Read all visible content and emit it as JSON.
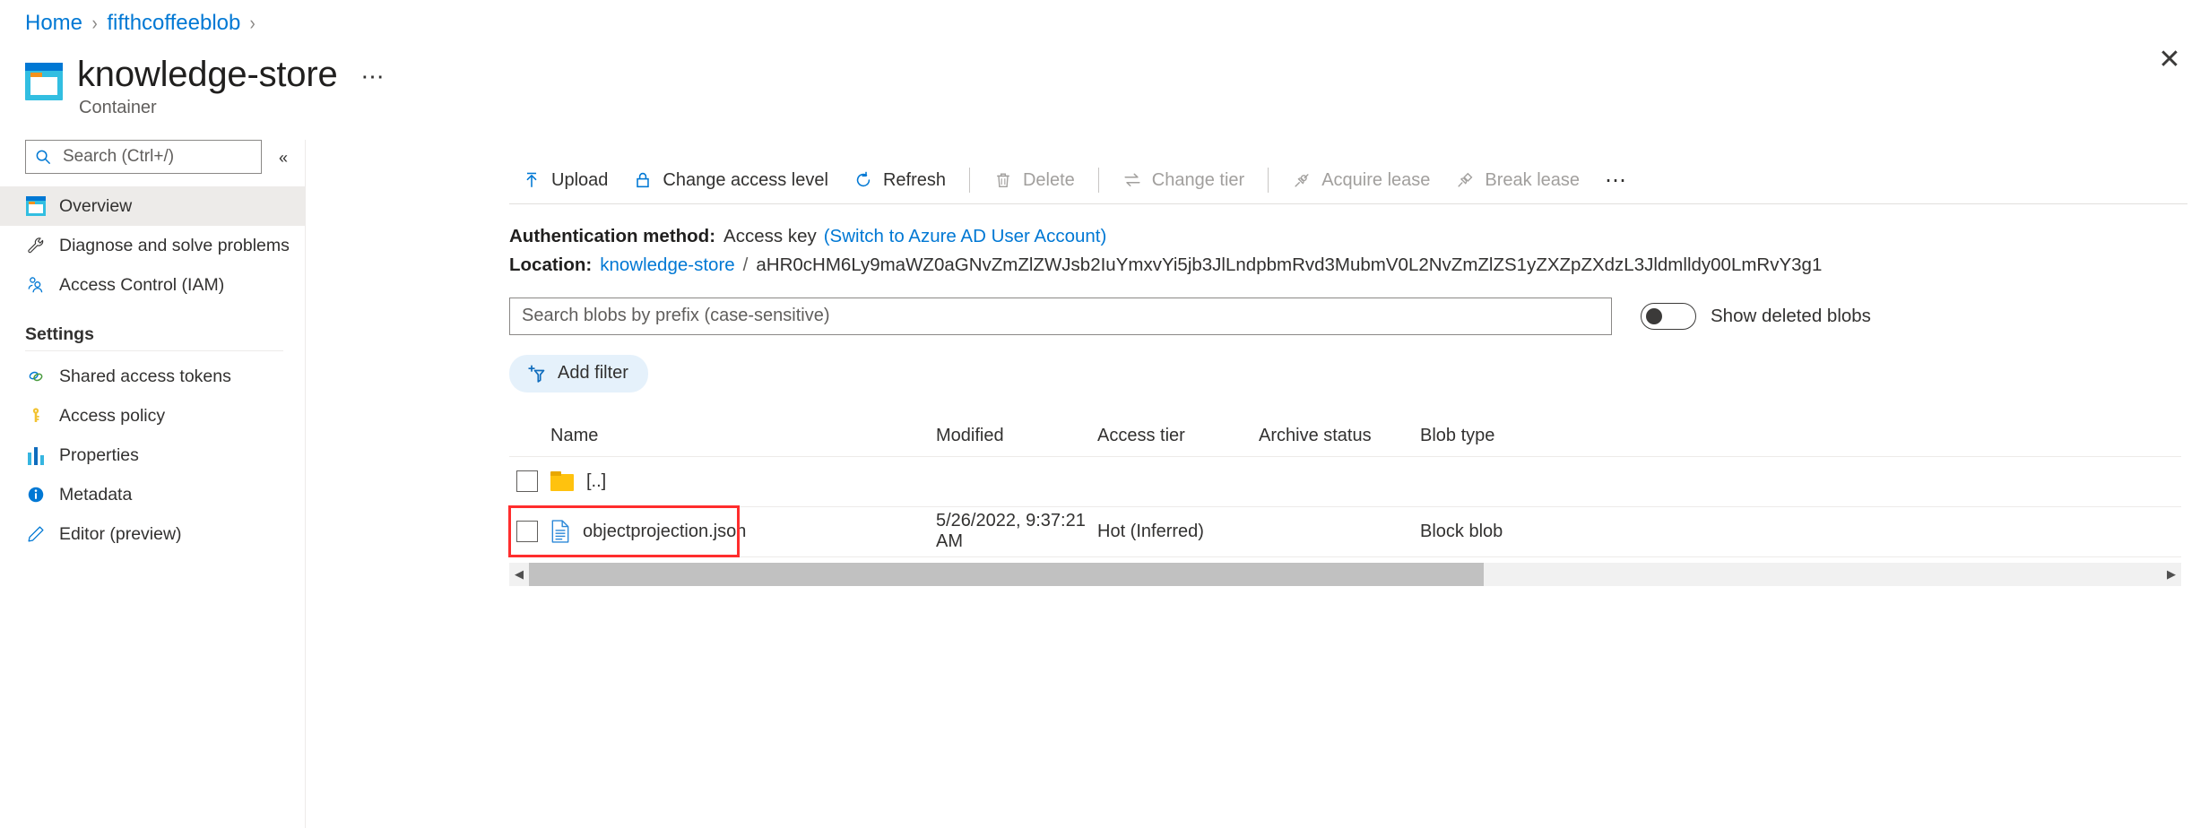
{
  "breadcrumb": {
    "items": [
      {
        "label": "Home"
      },
      {
        "label": "fifthcoffeeblob"
      }
    ],
    "separator": "›"
  },
  "header": {
    "title": "knowledge-store",
    "subtitle": "Container",
    "ellipsis": "⋯",
    "close_label": "✕"
  },
  "sidebar": {
    "search": {
      "placeholder": "Search (Ctrl+/)",
      "value": ""
    },
    "collapse_label": "«",
    "items": [
      {
        "label": "Overview",
        "icon": "container-icon",
        "active": true
      },
      {
        "label": "Diagnose and solve problems",
        "icon": "wrench-icon",
        "active": false
      },
      {
        "label": "Access Control (IAM)",
        "icon": "people-icon",
        "active": false
      }
    ],
    "section_title": "Settings",
    "settings_items": [
      {
        "label": "Shared access tokens",
        "icon": "link-icon"
      },
      {
        "label": "Access policy",
        "icon": "key-icon"
      },
      {
        "label": "Properties",
        "icon": "properties-icon"
      },
      {
        "label": "Metadata",
        "icon": "info-icon"
      },
      {
        "label": "Editor (preview)",
        "icon": "pencil-icon"
      }
    ]
  },
  "toolbar": {
    "buttons": [
      {
        "label": "Upload",
        "icon": "upload-icon",
        "disabled": false
      },
      {
        "label": "Change access level",
        "icon": "lock-icon",
        "disabled": false
      },
      {
        "label": "Refresh",
        "icon": "refresh-icon",
        "disabled": false
      },
      {
        "label": "Delete",
        "icon": "trash-icon",
        "disabled": true
      },
      {
        "label": "Change tier",
        "icon": "swap-icon",
        "disabled": true
      },
      {
        "label": "Acquire lease",
        "icon": "plug-icon",
        "disabled": true
      },
      {
        "label": "Break lease",
        "icon": "plug-break-icon",
        "disabled": true
      }
    ],
    "overflow": "⋯"
  },
  "info": {
    "auth_label": "Authentication method:",
    "auth_value": "Access key",
    "auth_link": "(Switch to Azure AD User Account)",
    "location_label": "Location:",
    "location_container": "knowledge-store",
    "location_separator": "/",
    "location_path": "aHR0cHM6Ly9maWZ0aGNvZmZlZWJsb2IuYmxvYi5jb3JlLndpbmRvd3MubmV0L2NvZmZlZS1yZXZpZXdzL3Jldmlldy00LmRvY3g1"
  },
  "filters": {
    "prefix_search": {
      "placeholder": "Search blobs by prefix (case-sensitive)",
      "value": ""
    },
    "show_deleted_label": "Show deleted blobs",
    "show_deleted_on": false,
    "add_filter_label": "Add filter"
  },
  "table": {
    "columns": [
      "Name",
      "Modified",
      "Access tier",
      "Archive status",
      "Blob type"
    ],
    "rows": [
      {
        "name": "[..]",
        "icon": "folder-icon",
        "modified": "",
        "access_tier": "",
        "archive_status": "",
        "blob_type": "",
        "highlighted": false
      },
      {
        "name": "objectprojection.json",
        "icon": "json-file-icon",
        "modified": "5/26/2022, 9:37:21 AM",
        "access_tier": "Hot (Inferred)",
        "archive_status": "",
        "blob_type": "Block blob",
        "highlighted": true
      }
    ]
  },
  "scrollbar": {
    "left_arrow": "◀",
    "right_arrow": "▶"
  },
  "colors": {
    "accent": "#0078d4",
    "highlight_red": "#ff2d2d",
    "folder_yellow": "#ffc20e",
    "container_cyan": "#32bee1"
  }
}
